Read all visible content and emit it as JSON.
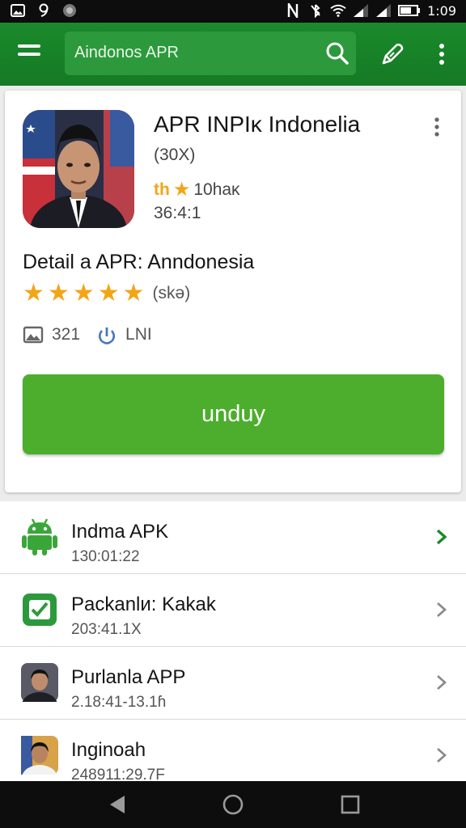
{
  "status_bar": {
    "time": "1:09",
    "left_icons": [
      "image-icon",
      "notification-9-icon",
      "circle-icon"
    ],
    "right_icons": [
      "nfc-icon",
      "mute-icon",
      "wifi-icon",
      "signal-icon",
      "signal-icon",
      "battery-icon"
    ]
  },
  "toolbar": {
    "search_text": "Aindonos APR",
    "icons": [
      "menu-icon",
      "search-icon",
      "edit-icon",
      "more-vert-icon"
    ],
    "accent_color": "#1a8a2b"
  },
  "app_card": {
    "title": "APR INPIĸ Indonelia",
    "subtitle": "(30X)",
    "rating_prefix": "th",
    "rating_text": "10haĸ",
    "size": "36:4:1",
    "detail_title": "Detail a APR: Anndonesia",
    "star_count": 5,
    "star_note": "(skə)",
    "meta_count": "321",
    "meta_text": "LNI",
    "download_label": "unduy",
    "download_color": "#4cae2c"
  },
  "list": {
    "items": [
      {
        "title": "Indma APK",
        "subtitle": "130:01:22",
        "icon": "android-icon"
      },
      {
        "title": "Packanlи: Kakak",
        "subtitle": "203:41.1X",
        "icon": "check-app-icon"
      },
      {
        "title": "Purlanla APP",
        "subtitle": "2.18:41-13.1ɦ",
        "icon": "portrait-icon"
      },
      {
        "title": "Inginoah",
        "subtitle": "248911:29.7F",
        "icon": "portrait-icon"
      }
    ]
  },
  "nav_bar": {
    "icons": [
      "back-icon",
      "home-icon",
      "recents-icon"
    ]
  }
}
